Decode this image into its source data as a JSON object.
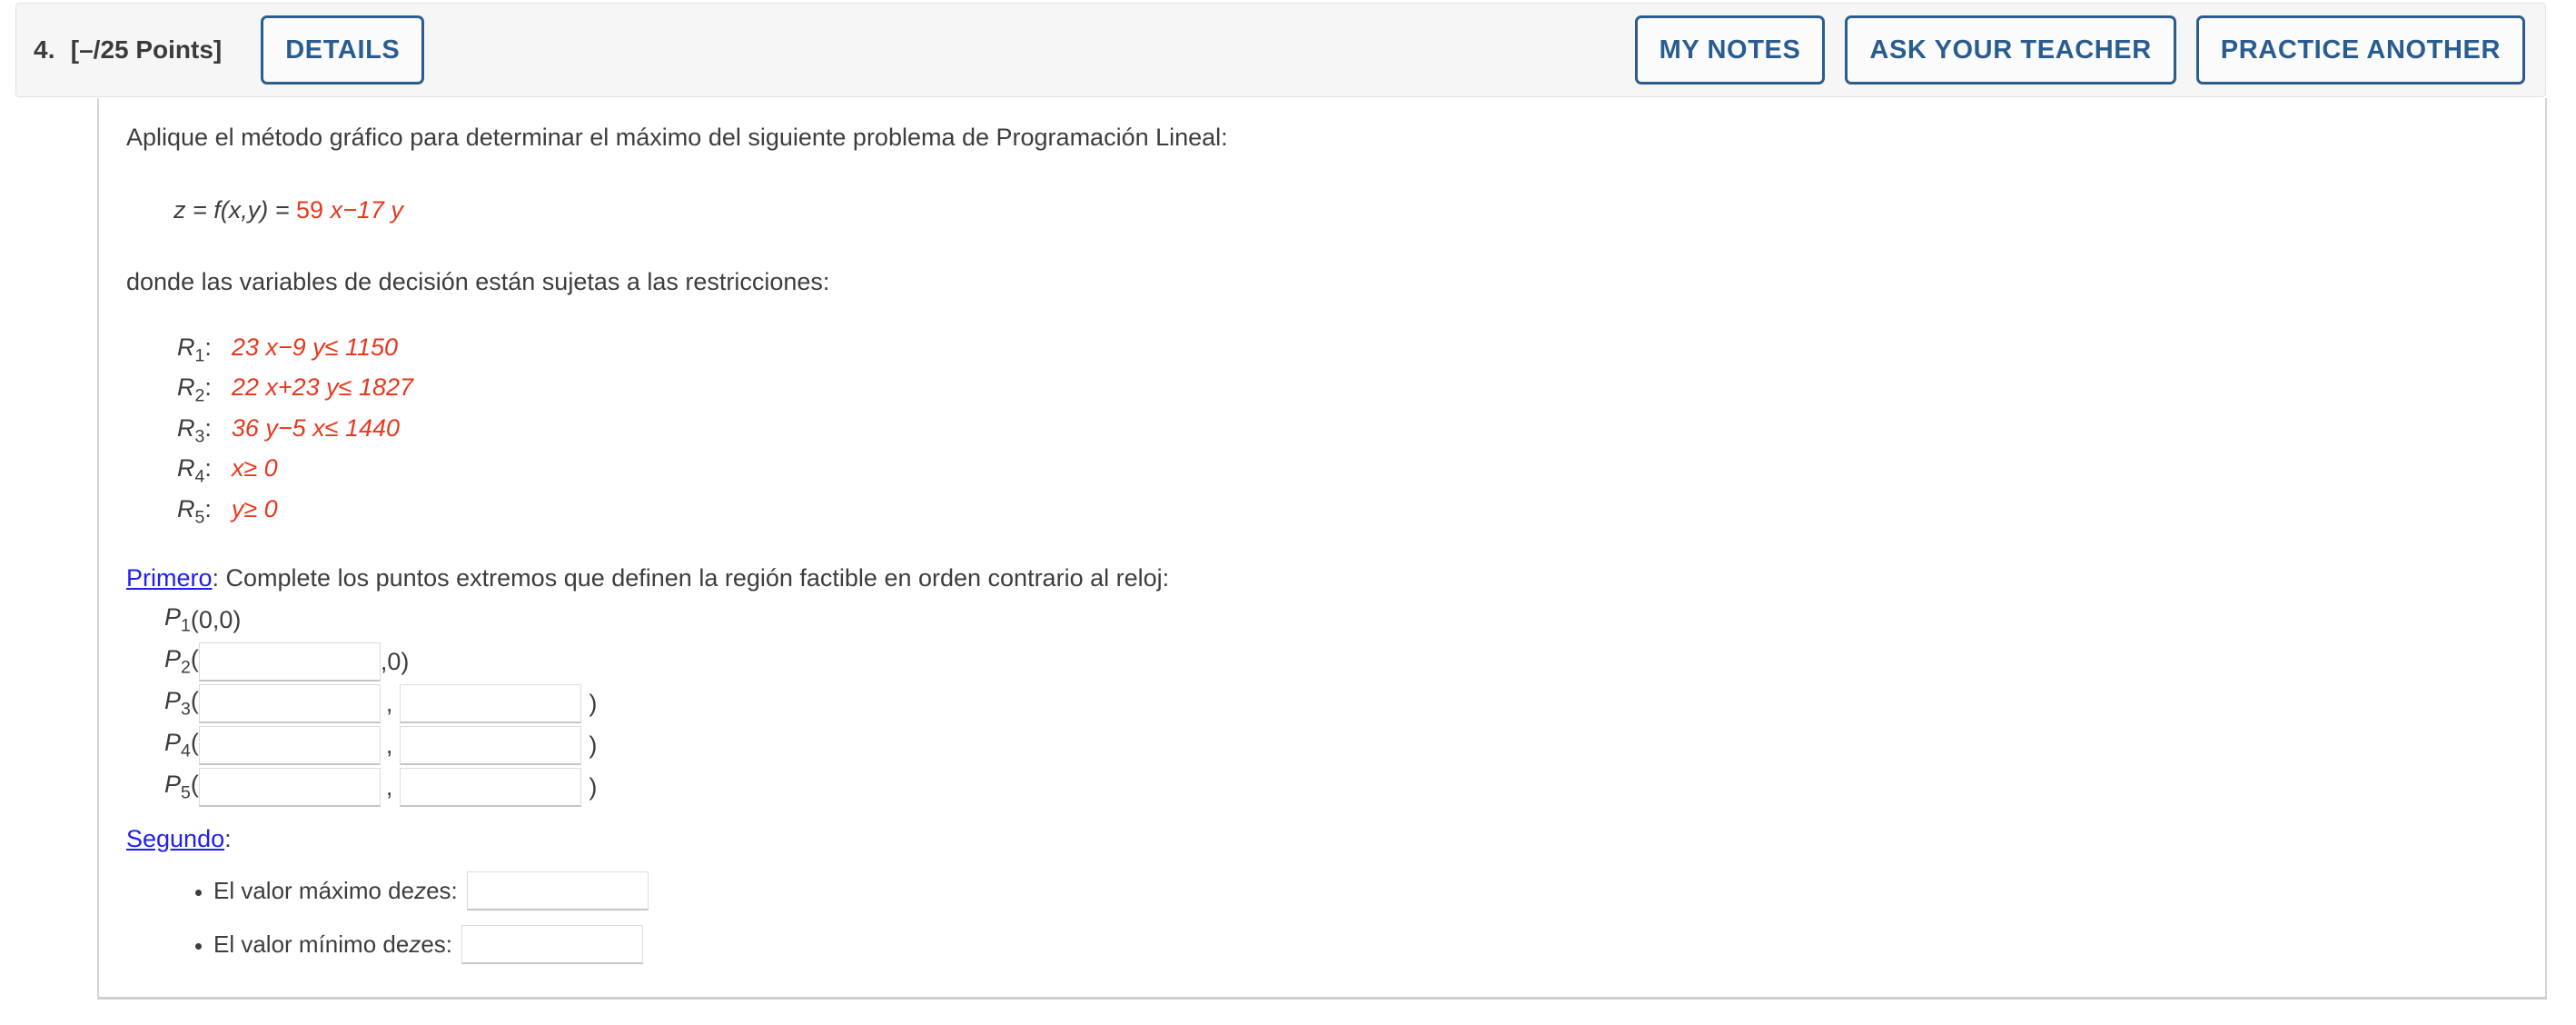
{
  "header": {
    "question_number": "4.",
    "points": "[–/25 Points]",
    "details_label": "DETAILS",
    "my_notes_label": "MY NOTES",
    "ask_teacher_label": "ASK YOUR TEACHER",
    "practice_another_label": "PRACTICE ANOTHER"
  },
  "colors": {
    "accent_blue": "#2a5d8f",
    "link_blue": "#2020ee",
    "math_red": "#e8381f",
    "header_bg": "#f6f6f6",
    "text": "#3d3d3d"
  },
  "body": {
    "intro": "Aplique el método gráfico para determinar el máximo del siguiente problema de Programación Lineal:",
    "objective": {
      "lhs": "z = f(x,y) = ",
      "coef_x": "59 ",
      "var_x": "x",
      "op": "−17 ",
      "var_y": "y"
    },
    "subject_text": "donde las variables de decisión están sujetas a las restricciones:",
    "constraints": [
      {
        "name": "R",
        "sub": "1",
        "colon": ":",
        "expr": "23 x−9 y≤ 1150"
      },
      {
        "name": "R",
        "sub": "2",
        "colon": ":",
        "expr": "22 x+23 y≤ 1827"
      },
      {
        "name": "R",
        "sub": "3",
        "colon": ":",
        "expr": "36 y−5 x≤ 1440"
      },
      {
        "name": "R",
        "sub": "4",
        "colon": ":",
        "expr": "x≥ 0"
      },
      {
        "name": "R",
        "sub": "5",
        "colon": ":",
        "expr": "y≥ 0"
      }
    ],
    "primero": {
      "link_label": "Primero",
      "instruction": ": Complete los puntos extremos que definen la región factible en orden contrario al reloj:",
      "p1_text": "P",
      "p1_sub": "1",
      "p1_coords": "(0,0)",
      "rows": [
        {
          "label": "P",
          "sub": "2",
          "open": "(",
          "x_value": "",
          "x_placeholder": "",
          "sep": ",0)",
          "has_y_field": false,
          "y_value": "",
          "close": ""
        },
        {
          "label": "P",
          "sub": "3",
          "open": "(",
          "x_value": "",
          "x_placeholder": "",
          "sep": ",",
          "has_y_field": true,
          "y_value": "",
          "close": ")"
        },
        {
          "label": "P",
          "sub": "4",
          "open": "(",
          "x_value": "",
          "x_placeholder": "",
          "sep": ",",
          "has_y_field": true,
          "y_value": "",
          "close": ")"
        },
        {
          "label": "P",
          "sub": "5",
          "open": "(",
          "x_value": "",
          "x_placeholder": "",
          "sep": ",",
          "has_y_field": true,
          "y_value": "",
          "close": ")"
        }
      ]
    },
    "segundo": {
      "link_label": "Segundo",
      "colon": ":",
      "items": [
        {
          "text_before": "El valor máximo de ",
          "var": "z",
          "text_after": " es:",
          "value": "",
          "placeholder": ""
        },
        {
          "text_before": "El valor mínimo de ",
          "var": "z",
          "text_after": " es:",
          "value": "",
          "placeholder": ""
        }
      ]
    }
  }
}
